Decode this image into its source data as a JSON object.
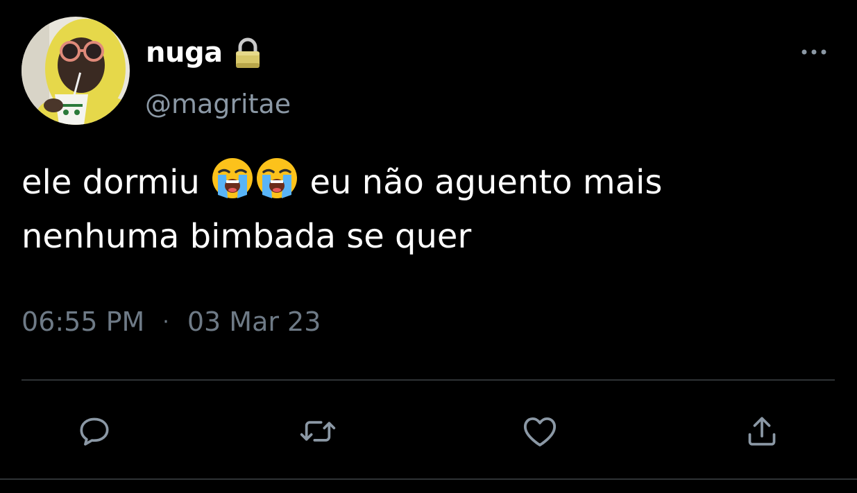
{
  "author": {
    "display_name": "nuga",
    "handle": "@magritae",
    "avatar_icon": "avatar-photo",
    "protected_icon": "lock-icon"
  },
  "tweet": {
    "text_line1_part1": "ele dormiu",
    "text_line1_part2": "eu não aguento mais",
    "text_line2": "nenhuma bimbada se quer",
    "emoji": "loudly-crying-face"
  },
  "meta": {
    "time": "06:55 PM",
    "separator": "·",
    "date": "03 Mar 23"
  },
  "actions": {
    "reply_icon": "reply-icon",
    "retweet_icon": "retweet-icon",
    "like_icon": "heart-icon",
    "share_icon": "share-icon",
    "more_icon": "more-icon"
  },
  "colors": {
    "background": "#000000",
    "text_primary": "#ffffff",
    "text_secondary": "#8b98a5",
    "divider": "#2f3336",
    "icon": "#8b98a5"
  }
}
